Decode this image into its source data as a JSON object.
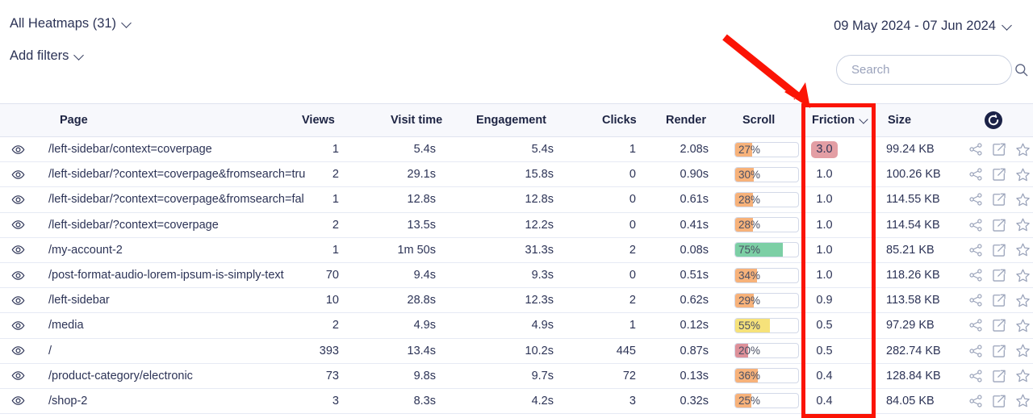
{
  "toolbar": {
    "heatmap_selector_label": "All Heatmaps (31)",
    "add_filters_label": "Add filters",
    "date_range_label": "09 May 2024 - 07 Jun 2024",
    "search_placeholder": "Search",
    "search_value": ""
  },
  "table": {
    "columns": {
      "page": "Page",
      "views": "Views",
      "visit_time": "Visit time",
      "engagement": "Engagement",
      "clicks": "Clicks",
      "render": "Render",
      "scroll": "Scroll",
      "friction": "Friction",
      "size": "Size"
    },
    "sorted_column": "Friction",
    "rows": [
      {
        "page": "/left-sidebar/context=coverpage",
        "views": "1",
        "visit_time": "5.4s",
        "engagement": "5.4s",
        "clicks": "1",
        "render": "2.08s",
        "scroll": "27%",
        "scroll_pct": 27,
        "scroll_color": "#f7b27a",
        "friction": "3.0",
        "friction_badge": true,
        "friction_bg": "#e39ea4",
        "size": "99.24 KB"
      },
      {
        "page": "/left-sidebar/?context=coverpage&fromsearch=tru",
        "views": "2",
        "visit_time": "29.1s",
        "engagement": "15.8s",
        "clicks": "0",
        "render": "0.90s",
        "scroll": "30%",
        "scroll_pct": 30,
        "scroll_color": "#f7b27a",
        "friction": "1.0",
        "friction_badge": false,
        "friction_bg": "",
        "size": "100.26 KB"
      },
      {
        "page": "/left-sidebar/?context=coverpage&fromsearch=fal",
        "views": "1",
        "visit_time": "12.8s",
        "engagement": "12.8s",
        "clicks": "0",
        "render": "0.61s",
        "scroll": "28%",
        "scroll_pct": 28,
        "scroll_color": "#f7b27a",
        "friction": "1.0",
        "friction_badge": false,
        "friction_bg": "",
        "size": "114.55 KB"
      },
      {
        "page": "/left-sidebar/?context=coverpage",
        "views": "2",
        "visit_time": "13.5s",
        "engagement": "12.2s",
        "clicks": "0",
        "render": "0.41s",
        "scroll": "28%",
        "scroll_pct": 28,
        "scroll_color": "#f7b27a",
        "friction": "1.0",
        "friction_badge": false,
        "friction_bg": "",
        "size": "114.54 KB"
      },
      {
        "page": "/my-account-2",
        "views": "1",
        "visit_time": "1m 50s",
        "engagement": "31.3s",
        "clicks": "2",
        "render": "0.08s",
        "scroll": "75%",
        "scroll_pct": 75,
        "scroll_color": "#7ccfa5",
        "friction": "1.0",
        "friction_badge": false,
        "friction_bg": "",
        "size": "85.21 KB"
      },
      {
        "page": "/post-format-audio-lorem-ipsum-is-simply-text",
        "views": "70",
        "visit_time": "9.4s",
        "engagement": "9.3s",
        "clicks": "0",
        "render": "0.51s",
        "scroll": "34%",
        "scroll_pct": 34,
        "scroll_color": "#f7b27a",
        "friction": "1.0",
        "friction_badge": false,
        "friction_bg": "",
        "size": "118.26 KB"
      },
      {
        "page": "/left-sidebar",
        "views": "10",
        "visit_time": "28.8s",
        "engagement": "12.3s",
        "clicks": "2",
        "render": "0.62s",
        "scroll": "29%",
        "scroll_pct": 29,
        "scroll_color": "#f7b27a",
        "friction": "0.9",
        "friction_badge": false,
        "friction_bg": "",
        "size": "113.58 KB"
      },
      {
        "page": "/media",
        "views": "2",
        "visit_time": "4.9s",
        "engagement": "4.9s",
        "clicks": "1",
        "render": "0.12s",
        "scroll": "55%",
        "scroll_pct": 55,
        "scroll_color": "#f6e27a",
        "friction": "0.5",
        "friction_badge": false,
        "friction_bg": "",
        "size": "97.29 KB"
      },
      {
        "page": "/",
        "views": "393",
        "visit_time": "13.4s",
        "engagement": "10.2s",
        "clicks": "445",
        "render": "0.87s",
        "scroll": "20%",
        "scroll_pct": 20,
        "scroll_color": "#dd9099",
        "friction": "0.5",
        "friction_badge": false,
        "friction_bg": "",
        "size": "282.74 KB"
      },
      {
        "page": "/product-category/electronic",
        "views": "73",
        "visit_time": "9.8s",
        "engagement": "9.7s",
        "clicks": "72",
        "render": "0.13s",
        "scroll": "36%",
        "scroll_pct": 36,
        "scroll_color": "#f7b27a",
        "friction": "0.4",
        "friction_badge": false,
        "friction_bg": "",
        "size": "128.84 KB"
      },
      {
        "page": "/shop-2",
        "views": "3",
        "visit_time": "8.3s",
        "engagement": "4.2s",
        "clicks": "3",
        "render": "0.32s",
        "scroll": "25%",
        "scroll_pct": 25,
        "scroll_color": "#f7b27a",
        "friction": "0.4",
        "friction_badge": false,
        "friction_bg": "",
        "size": "84.05 KB"
      }
    ]
  },
  "icons": {
    "eye": "eye-icon",
    "share": "share-icon",
    "open": "open-external-icon",
    "star": "star-icon",
    "refresh": "refresh-icon",
    "search": "search-icon"
  },
  "annotation": {
    "highlight_color": "#fb1405",
    "highlight_target": "Friction"
  }
}
